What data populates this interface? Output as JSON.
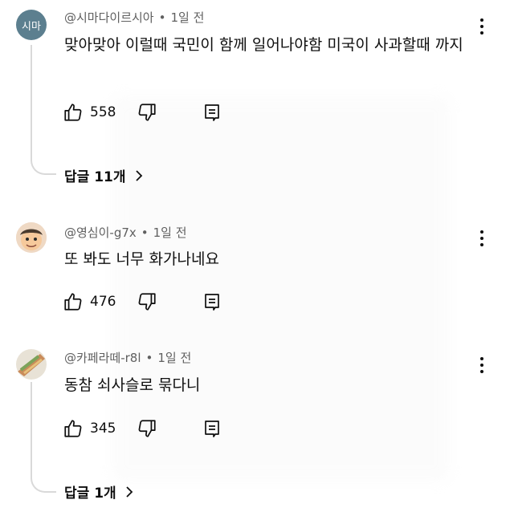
{
  "comments": [
    {
      "avatar_text": "시마",
      "avatar_color": "#5c7f8f",
      "author": "@시마다이르시아",
      "time": "1일 전",
      "text": "맞아맞아 이럴때 국민이 함께 일어나야함 미국이 사과할때 까지",
      "likes": "558",
      "replies": "답글 11개"
    },
    {
      "author": "@영심이-g7x",
      "time": "1일 전",
      "text": "또 봐도 너무 화가나네요",
      "likes": "476"
    },
    {
      "author": "@카페라떼-r8l",
      "time": "1일 전",
      "text": "동참 쇠사슬로 묶다니",
      "likes": "345",
      "replies": "답글 1개"
    }
  ],
  "separator": "•"
}
